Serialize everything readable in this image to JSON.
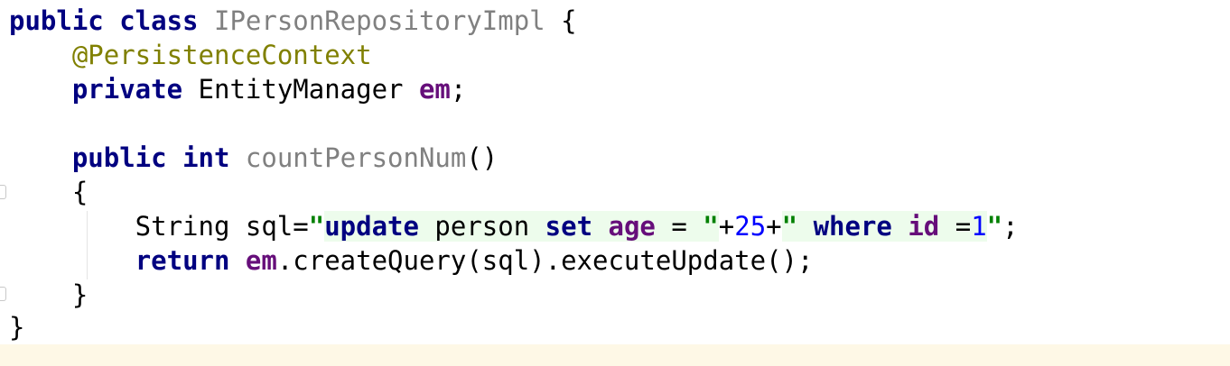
{
  "lines": [
    [
      {
        "text": "public ",
        "cls": "kw"
      },
      {
        "text": "class ",
        "cls": "kw"
      },
      {
        "text": "IPersonRepositoryImpl",
        "cls": "unused"
      },
      {
        "text": " {",
        "cls": ""
      }
    ],
    [
      {
        "text": "    ",
        "cls": ""
      },
      {
        "text": "@PersistenceContext",
        "cls": "anno"
      }
    ],
    [
      {
        "text": "    ",
        "cls": ""
      },
      {
        "text": "private ",
        "cls": "kw"
      },
      {
        "text": "EntityManager ",
        "cls": ""
      },
      {
        "text": "em",
        "cls": "field"
      },
      {
        "text": ";",
        "cls": ""
      }
    ],
    [],
    [
      {
        "text": "    ",
        "cls": ""
      },
      {
        "text": "public ",
        "cls": "kw"
      },
      {
        "text": "int ",
        "cls": "kw"
      },
      {
        "text": "countPersonNum",
        "cls": "unused"
      },
      {
        "text": "()",
        "cls": ""
      }
    ],
    [
      {
        "text": "    {",
        "cls": ""
      }
    ],
    [
      {
        "text": "        String sql=",
        "cls": ""
      },
      {
        "text": "\"",
        "cls": "str"
      },
      {
        "text": "update",
        "cls": "kw inj"
      },
      {
        "text": " person ",
        "cls": "inj"
      },
      {
        "text": "set",
        "cls": "kw inj"
      },
      {
        "text": " ",
        "cls": "inj"
      },
      {
        "text": "age",
        "cls": "field inj"
      },
      {
        "text": " = ",
        "cls": "inj"
      },
      {
        "text": "\"",
        "cls": "str inj"
      },
      {
        "text": "+",
        "cls": ""
      },
      {
        "text": "25",
        "cls": "num"
      },
      {
        "text": "+",
        "cls": ""
      },
      {
        "text": "\"",
        "cls": "str inj"
      },
      {
        "text": " ",
        "cls": "inj"
      },
      {
        "text": "where",
        "cls": "kw inj"
      },
      {
        "text": " ",
        "cls": "inj"
      },
      {
        "text": "id",
        "cls": "field inj"
      },
      {
        "text": " =",
        "cls": "inj"
      },
      {
        "text": "1",
        "cls": "num inj"
      },
      {
        "text": "\"",
        "cls": "str"
      },
      {
        "text": ";",
        "cls": ""
      }
    ],
    [
      {
        "text": "        ",
        "cls": ""
      },
      {
        "text": "return ",
        "cls": "kw"
      },
      {
        "text": "em",
        "cls": "field"
      },
      {
        "text": ".createQuery(sql).executeUpdate();",
        "cls": ""
      }
    ],
    [
      {
        "text": "    }",
        "cls": ""
      }
    ],
    [
      {
        "text": "}",
        "cls": ""
      }
    ]
  ]
}
